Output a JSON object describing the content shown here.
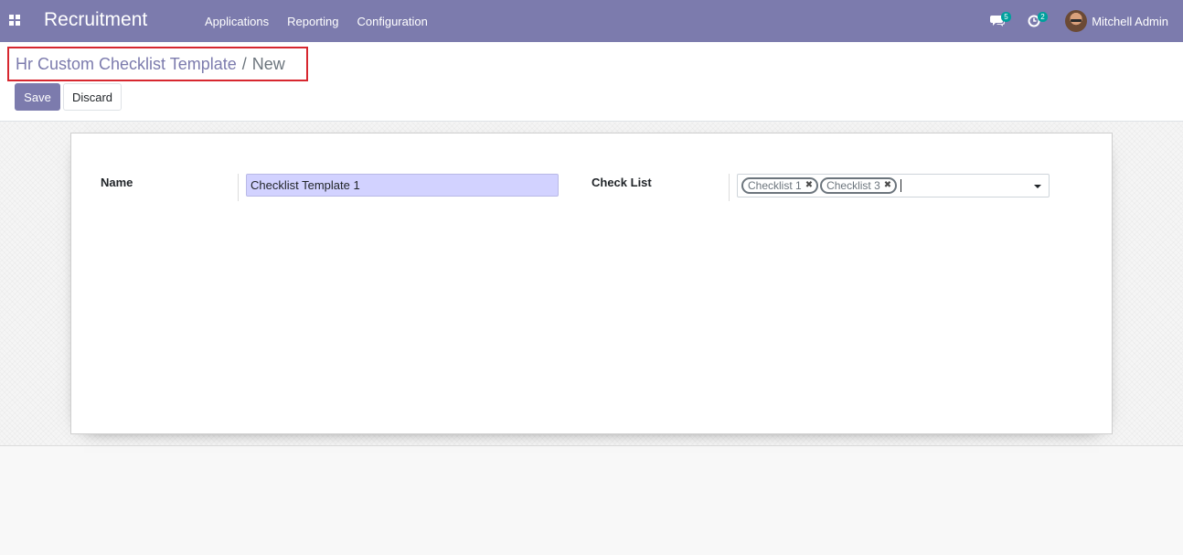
{
  "navbar": {
    "app_title": "Recruitment",
    "menu": [
      "Applications",
      "Reporting",
      "Configuration"
    ],
    "messages_badge": "5",
    "activities_badge": "2",
    "user_name": "Mitchell Admin"
  },
  "breadcrumb": {
    "parent": "Hr Custom Checklist Template",
    "separator": "/",
    "current": "New"
  },
  "buttons": {
    "save": "Save",
    "discard": "Discard"
  },
  "form": {
    "name_label": "Name",
    "name_value": "Checklist Template 1",
    "checklist_label": "Check List",
    "checklist_tags": [
      "Checklist 1",
      "Checklist 3"
    ]
  },
  "colors": {
    "brand": "#7c7bad",
    "highlight_box": "#d7272f",
    "badge": "#00a09d"
  }
}
